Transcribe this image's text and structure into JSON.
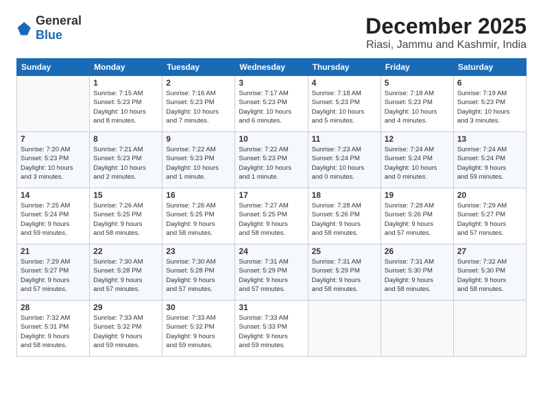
{
  "header": {
    "logo": {
      "general": "General",
      "blue": "Blue"
    },
    "title": "December 2025",
    "location": "Riasi, Jammu and Kashmir, India"
  },
  "calendar": {
    "days_of_week": [
      "Sunday",
      "Monday",
      "Tuesday",
      "Wednesday",
      "Thursday",
      "Friday",
      "Saturday"
    ],
    "weeks": [
      [
        {
          "day": "",
          "info": ""
        },
        {
          "day": "1",
          "info": "Sunrise: 7:15 AM\nSunset: 5:23 PM\nDaylight: 10 hours\nand 8 minutes."
        },
        {
          "day": "2",
          "info": "Sunrise: 7:16 AM\nSunset: 5:23 PM\nDaylight: 10 hours\nand 7 minutes."
        },
        {
          "day": "3",
          "info": "Sunrise: 7:17 AM\nSunset: 5:23 PM\nDaylight: 10 hours\nand 6 minutes."
        },
        {
          "day": "4",
          "info": "Sunrise: 7:18 AM\nSunset: 5:23 PM\nDaylight: 10 hours\nand 5 minutes."
        },
        {
          "day": "5",
          "info": "Sunrise: 7:18 AM\nSunset: 5:23 PM\nDaylight: 10 hours\nand 4 minutes."
        },
        {
          "day": "6",
          "info": "Sunrise: 7:19 AM\nSunset: 5:23 PM\nDaylight: 10 hours\nand 3 minutes."
        }
      ],
      [
        {
          "day": "7",
          "info": "Sunrise: 7:20 AM\nSunset: 5:23 PM\nDaylight: 10 hours\nand 3 minutes."
        },
        {
          "day": "8",
          "info": "Sunrise: 7:21 AM\nSunset: 5:23 PM\nDaylight: 10 hours\nand 2 minutes."
        },
        {
          "day": "9",
          "info": "Sunrise: 7:22 AM\nSunset: 5:23 PM\nDaylight: 10 hours\nand 1 minute."
        },
        {
          "day": "10",
          "info": "Sunrise: 7:22 AM\nSunset: 5:23 PM\nDaylight: 10 hours\nand 1 minute."
        },
        {
          "day": "11",
          "info": "Sunrise: 7:23 AM\nSunset: 5:24 PM\nDaylight: 10 hours\nand 0 minutes."
        },
        {
          "day": "12",
          "info": "Sunrise: 7:24 AM\nSunset: 5:24 PM\nDaylight: 10 hours\nand 0 minutes."
        },
        {
          "day": "13",
          "info": "Sunrise: 7:24 AM\nSunset: 5:24 PM\nDaylight: 9 hours\nand 59 minutes."
        }
      ],
      [
        {
          "day": "14",
          "info": "Sunrise: 7:25 AM\nSunset: 5:24 PM\nDaylight: 9 hours\nand 59 minutes."
        },
        {
          "day": "15",
          "info": "Sunrise: 7:26 AM\nSunset: 5:25 PM\nDaylight: 9 hours\nand 58 minutes."
        },
        {
          "day": "16",
          "info": "Sunrise: 7:26 AM\nSunset: 5:25 PM\nDaylight: 9 hours\nand 58 minutes."
        },
        {
          "day": "17",
          "info": "Sunrise: 7:27 AM\nSunset: 5:25 PM\nDaylight: 9 hours\nand 58 minutes."
        },
        {
          "day": "18",
          "info": "Sunrise: 7:28 AM\nSunset: 5:26 PM\nDaylight: 9 hours\nand 58 minutes."
        },
        {
          "day": "19",
          "info": "Sunrise: 7:28 AM\nSunset: 5:26 PM\nDaylight: 9 hours\nand 57 minutes."
        },
        {
          "day": "20",
          "info": "Sunrise: 7:29 AM\nSunset: 5:27 PM\nDaylight: 9 hours\nand 57 minutes."
        }
      ],
      [
        {
          "day": "21",
          "info": "Sunrise: 7:29 AM\nSunset: 5:27 PM\nDaylight: 9 hours\nand 57 minutes."
        },
        {
          "day": "22",
          "info": "Sunrise: 7:30 AM\nSunset: 5:28 PM\nDaylight: 9 hours\nand 57 minutes."
        },
        {
          "day": "23",
          "info": "Sunrise: 7:30 AM\nSunset: 5:28 PM\nDaylight: 9 hours\nand 57 minutes."
        },
        {
          "day": "24",
          "info": "Sunrise: 7:31 AM\nSunset: 5:29 PM\nDaylight: 9 hours\nand 57 minutes."
        },
        {
          "day": "25",
          "info": "Sunrise: 7:31 AM\nSunset: 5:29 PM\nDaylight: 9 hours\nand 58 minutes."
        },
        {
          "day": "26",
          "info": "Sunrise: 7:31 AM\nSunset: 5:30 PM\nDaylight: 9 hours\nand 58 minutes."
        },
        {
          "day": "27",
          "info": "Sunrise: 7:32 AM\nSunset: 5:30 PM\nDaylight: 9 hours\nand 58 minutes."
        }
      ],
      [
        {
          "day": "28",
          "info": "Sunrise: 7:32 AM\nSunset: 5:31 PM\nDaylight: 9 hours\nand 58 minutes."
        },
        {
          "day": "29",
          "info": "Sunrise: 7:33 AM\nSunset: 5:32 PM\nDaylight: 9 hours\nand 59 minutes."
        },
        {
          "day": "30",
          "info": "Sunrise: 7:33 AM\nSunset: 5:32 PM\nDaylight: 9 hours\nand 59 minutes."
        },
        {
          "day": "31",
          "info": "Sunrise: 7:33 AM\nSunset: 5:33 PM\nDaylight: 9 hours\nand 59 minutes."
        },
        {
          "day": "",
          "info": ""
        },
        {
          "day": "",
          "info": ""
        },
        {
          "day": "",
          "info": ""
        }
      ]
    ]
  }
}
